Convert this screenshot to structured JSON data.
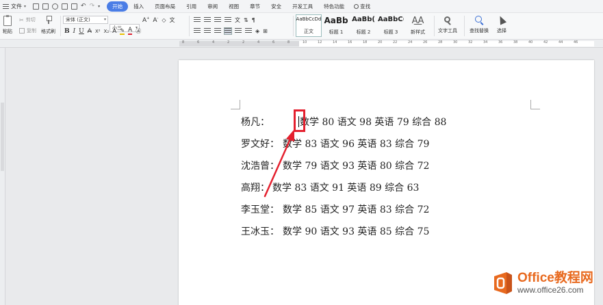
{
  "menubar": {
    "file_label": "文件",
    "tabs": [
      {
        "label": "开始",
        "active": true
      },
      {
        "label": "插入",
        "active": false
      },
      {
        "label": "页面布局",
        "active": false
      },
      {
        "label": "引用",
        "active": false
      },
      {
        "label": "审阅",
        "active": false
      },
      {
        "label": "视图",
        "active": false
      },
      {
        "label": "章节",
        "active": false
      },
      {
        "label": "安全",
        "active": false
      },
      {
        "label": "开发工具",
        "active": false
      },
      {
        "label": "特色功能",
        "active": false
      }
    ],
    "search_label": "查找"
  },
  "ribbon": {
    "paste_label": "粘贴",
    "cut_label": "剪切",
    "copy_label": "复制",
    "format_painter_label": "格式刷",
    "font_name": "宋体 (正文)",
    "font_size": "小三",
    "styles": [
      {
        "preview": "AaBbCcDd",
        "name": "正文",
        "selected": true
      },
      {
        "preview": "AaBb",
        "name": "标题 1",
        "selected": false
      },
      {
        "preview": "AaBb(",
        "name": "标题 2",
        "selected": false
      },
      {
        "preview": "AaBbC(",
        "name": "标题 3",
        "selected": false
      }
    ],
    "new_style_label": "新样式",
    "text_tools_label": "文字工具",
    "find_replace_label": "查找替换",
    "select_label": "选择"
  },
  "ruler": {
    "ticks": [
      "8",
      "6",
      "4",
      "2",
      "2",
      "4",
      "6",
      "8",
      "10",
      "12",
      "14",
      "16",
      "18",
      "20",
      "22",
      "24",
      "26",
      "28",
      "30",
      "32",
      "34",
      "36",
      "38",
      "40",
      "42",
      "44",
      "46"
    ]
  },
  "document": {
    "lines": [
      {
        "name": "杨凡：",
        "scores": "数学 80 语文 98 英语 79 综合 88",
        "has_caret": true
      },
      {
        "name": "罗文好：",
        "scores": "数学 83 语文 96 英语 83 综合 79",
        "has_caret": false
      },
      {
        "name": "沈浩曾：",
        "scores": "数学 79 语文 93 英语 80 综合 72",
        "has_caret": false
      },
      {
        "name": "高翔：",
        "scores": "数学 83 语文 91 英语 89 综合 63",
        "has_caret": false
      },
      {
        "name": "李玉堂：",
        "scores": "数学 85 语文 97 英语 83 综合 72",
        "has_caret": false
      },
      {
        "name": "王冰玉：",
        "scores": "数学 90 语文 93 英语 85 综合 75",
        "has_caret": false
      }
    ]
  },
  "annotation": {
    "color": "#e4202e"
  },
  "watermark": {
    "title": "Office教程网",
    "url": "www.office26.com",
    "logo_color": "#e8691e"
  },
  "colors": {
    "accent": "#4a7de6"
  }
}
